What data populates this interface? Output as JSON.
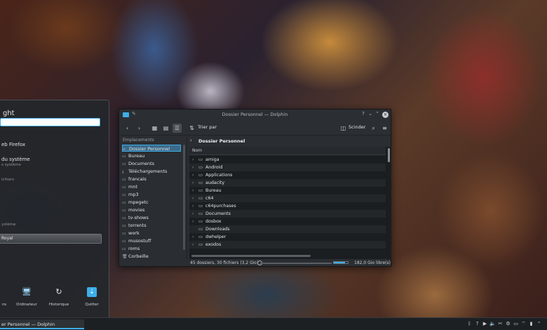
{
  "launcher": {
    "title": "ght",
    "entries": [
      {
        "label": "eb Firefox",
        "sub": ""
      },
      {
        "label": "du système",
        "sub": "s système"
      },
      {
        "label": "",
        "sub": "ichiers"
      },
      {
        "label": "",
        "sub": "ystème"
      }
    ],
    "selected_label": "Royal",
    "favorites": [
      {
        "icon": "overflow-icon",
        "label": "ns"
      },
      {
        "icon": "computer-icon",
        "label": "Ordinateur"
      },
      {
        "icon": "history-icon",
        "label": "Historique"
      },
      {
        "icon": "quit-icon",
        "label": "Quitter"
      }
    ]
  },
  "window": {
    "title": "Dossier Personnel — Dolphin",
    "toolbar": {
      "sort_label": "Trier par",
      "split_label": "Scinder"
    },
    "places": {
      "header": "Emplacements",
      "items": [
        {
          "label": "Dossier Personnel",
          "icon": "home-icon",
          "active": true
        },
        {
          "label": "Bureau",
          "icon": "desktop-icon"
        },
        {
          "label": "Documents",
          "icon": "folder-icon"
        },
        {
          "label": "Téléchargements",
          "icon": "download-icon"
        },
        {
          "label": "francais",
          "icon": "folder-icon"
        },
        {
          "label": "mnt",
          "icon": "folder-icon"
        },
        {
          "label": "mp3",
          "icon": "folder-icon"
        },
        {
          "label": "mpegetc",
          "icon": "folder-icon"
        },
        {
          "label": "movies",
          "icon": "folder-icon"
        },
        {
          "label": "tv-shows",
          "icon": "folder-icon"
        },
        {
          "label": "torrents",
          "icon": "folder-icon"
        },
        {
          "label": "work",
          "icon": "folder-icon"
        },
        {
          "label": "musostuff",
          "icon": "folder-icon"
        },
        {
          "label": "roms",
          "icon": "folder-icon"
        },
        {
          "label": "Corbeille",
          "icon": "trash-icon"
        }
      ]
    },
    "breadcrumb": "Dossier Personnel",
    "column_header": "Nom",
    "files": [
      {
        "name": "amiga",
        "expand": true
      },
      {
        "name": "Android",
        "expand": true
      },
      {
        "name": "Applications",
        "expand": true
      },
      {
        "name": "audacity",
        "expand": true
      },
      {
        "name": "Bureau",
        "expand": true
      },
      {
        "name": "c64",
        "expand": true
      },
      {
        "name": "c64purchases",
        "expand": true
      },
      {
        "name": "Documents",
        "expand": true
      },
      {
        "name": "dosbox",
        "expand": true
      },
      {
        "name": "Downloads",
        "expand": false
      },
      {
        "name": "dwhelper",
        "expand": true
      },
      {
        "name": "exodos",
        "expand": true
      }
    ],
    "status": {
      "summary": "45 dossiers, 30 fichiers (3,2 Gio)",
      "free_space": "182,0 Gio libre(s)",
      "disk_used_fraction": 0.8
    }
  },
  "taskbar": {
    "task_label": "er Personnel — Dolphin",
    "tray_icons": [
      "bluetooth-icon",
      "help-icon",
      "media-icon",
      "volume-icon",
      "clipboard-icon",
      "settings-icon",
      "display-icon",
      "network-icon",
      "battery-icon",
      "expand-icon"
    ]
  },
  "colors": {
    "accent": "#3daee9",
    "window_bg": "#2a2e32",
    "list_bg": "#1b1e20"
  }
}
